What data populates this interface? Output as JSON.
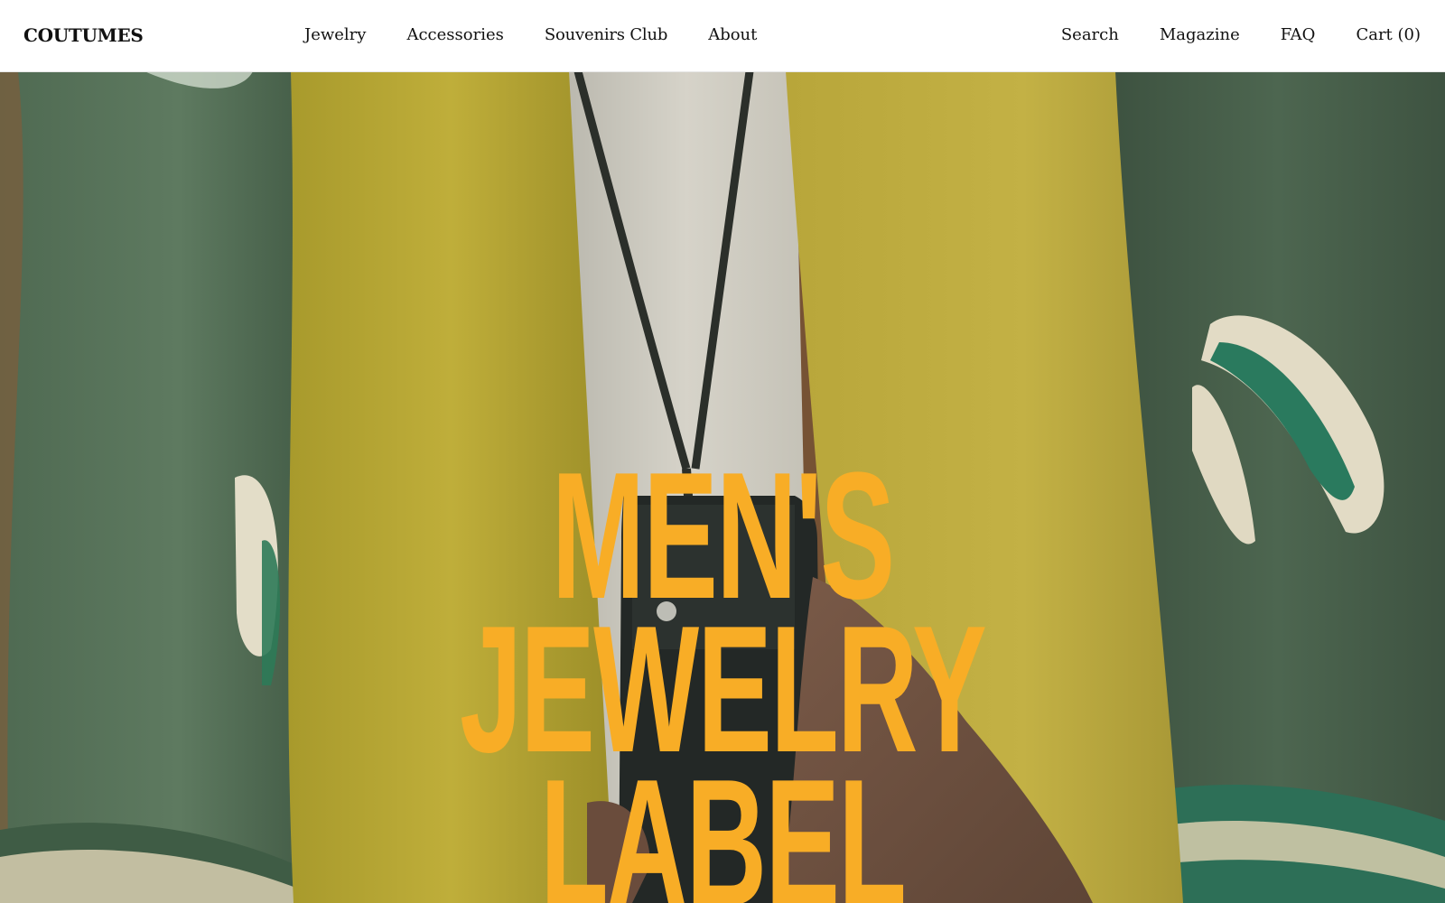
{
  "brand": {
    "name": "COUTUMES"
  },
  "nav": {
    "primary": [
      {
        "label": "Jewelry"
      },
      {
        "label": "Accessories"
      },
      {
        "label": "Souvenirs Club"
      },
      {
        "label": "About"
      }
    ],
    "secondary": [
      {
        "label": "Search"
      },
      {
        "label": "Magazine"
      },
      {
        "label": "FAQ"
      },
      {
        "label": "Cart (0)"
      }
    ]
  },
  "hero": {
    "headline_lines": [
      "MEN'S",
      "JEWELRY",
      "LABEL"
    ],
    "headline_color": "#f8ad26",
    "photo": "close-up of a person in a green varsity jacket with a mustard yellow scarf and a black leather pouch necklace"
  },
  "colors": {
    "header_bg": "#ffffff",
    "text": "#111111",
    "accent": "#f8ad26"
  }
}
